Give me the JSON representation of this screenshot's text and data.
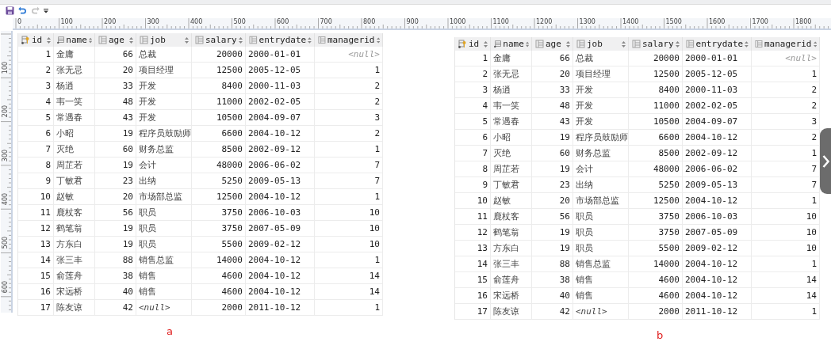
{
  "toolbar": {
    "buttons": [
      {
        "kind": "save",
        "disabled": false
      },
      {
        "kind": "undo",
        "disabled": false
      },
      {
        "kind": "redo",
        "disabled": true
      },
      {
        "kind": "menu",
        "disabled": false
      }
    ]
  },
  "ruler": {
    "horizontal_labels": [
      "0",
      "100",
      "200",
      "300",
      "400",
      "500",
      "600",
      "700",
      "800",
      "900",
      "1000",
      "1100",
      "1200",
      "1300",
      "1400",
      "1500",
      "1600",
      "1700",
      "1800"
    ],
    "vertical_labels": [
      "100",
      "200",
      "300",
      "400",
      "500",
      "600"
    ]
  },
  "tables": [
    {
      "caption": "a",
      "columns": [
        {
          "name": "id",
          "kind": "number"
        },
        {
          "name": "name",
          "kind": "text"
        },
        {
          "name": "age",
          "kind": "number"
        },
        {
          "name": "job",
          "kind": "text"
        },
        {
          "name": "salary",
          "kind": "number"
        },
        {
          "name": "entrydate",
          "kind": "text"
        },
        {
          "name": "managerid",
          "kind": "number"
        }
      ],
      "rows": [
        [
          "1",
          "金庸",
          "66",
          "总裁",
          "20000",
          "2000-01-01",
          {
            "text": "<null>",
            "kind": "null"
          }
        ],
        [
          "2",
          "张无忌",
          "20",
          "项目经理",
          "12500",
          "2005-12-05",
          "1"
        ],
        [
          "3",
          "杨逍",
          "33",
          "开发",
          "8400",
          "2000-11-03",
          "2"
        ],
        [
          "4",
          "韦一笑",
          "48",
          "开发",
          "11000",
          "2002-02-05",
          "2"
        ],
        [
          "5",
          "常遇春",
          "43",
          "开发",
          "10500",
          "2004-09-07",
          "3"
        ],
        [
          "6",
          "小昭",
          "19",
          "程序员鼓励师",
          "6600",
          "2004-10-12",
          "2"
        ],
        [
          "7",
          "灭绝",
          "60",
          "财务总监",
          "8500",
          "2002-09-12",
          "1"
        ],
        [
          "8",
          "周芷若",
          "19",
          "会计",
          "48000",
          "2006-06-02",
          "7"
        ],
        [
          "9",
          "丁敏君",
          "23",
          "出纳",
          "5250",
          "2009-05-13",
          "7"
        ],
        [
          "10",
          "赵敏",
          "20",
          "市场部总监",
          "12500",
          "2004-10-12",
          "1"
        ],
        [
          "11",
          "鹿杖客",
          "56",
          "职员",
          "3750",
          "2006-10-03",
          "10"
        ],
        [
          "12",
          "鹤笔翁",
          "19",
          "职员",
          "3750",
          "2007-05-09",
          "10"
        ],
        [
          "13",
          "方东白",
          "19",
          "职员",
          "5500",
          "2009-02-12",
          "10"
        ],
        [
          "14",
          "张三丰",
          "88",
          "销售总监",
          "14000",
          "2004-10-12",
          "1"
        ],
        [
          "15",
          "俞莲舟",
          "38",
          "销售",
          "4600",
          "2004-10-12",
          "14"
        ],
        [
          "16",
          "宋远桥",
          "40",
          "销售",
          "4600",
          "2004-10-12",
          "14"
        ],
        [
          "17",
          "陈友谅",
          "42",
          {
            "text": "<null>",
            "kind": "null"
          },
          "2000",
          "2011-10-12",
          "1"
        ]
      ]
    },
    {
      "caption": "b",
      "columns": [
        {
          "name": "id",
          "kind": "number"
        },
        {
          "name": "name",
          "kind": "text"
        },
        {
          "name": "age",
          "kind": "number"
        },
        {
          "name": "job",
          "kind": "text"
        },
        {
          "name": "salary",
          "kind": "number"
        },
        {
          "name": "entrydate",
          "kind": "text"
        },
        {
          "name": "managerid",
          "kind": "number"
        }
      ],
      "rows": [
        [
          "1",
          "金庸",
          "66",
          "总裁",
          "20000",
          "2000-01-01",
          {
            "text": "<null>",
            "kind": "null"
          }
        ],
        [
          "2",
          "张无忌",
          "20",
          "项目经理",
          "12500",
          "2005-12-05",
          "1"
        ],
        [
          "3",
          "杨逍",
          "33",
          "开发",
          "8400",
          "2000-11-03",
          "2"
        ],
        [
          "4",
          "韦一笑",
          "48",
          "开发",
          "11000",
          "2002-02-05",
          "2"
        ],
        [
          "5",
          "常遇春",
          "43",
          "开发",
          "10500",
          "2004-09-07",
          "3"
        ],
        [
          "6",
          "小昭",
          "19",
          "程序员鼓励师",
          "6600",
          "2004-10-12",
          "2"
        ],
        [
          "7",
          "灭绝",
          "60",
          "财务总监",
          "8500",
          "2002-09-12",
          "1"
        ],
        [
          "8",
          "周芷若",
          "19",
          "会计",
          "48000",
          "2006-06-02",
          "7"
        ],
        [
          "9",
          "丁敏君",
          "23",
          "出纳",
          "5250",
          "2009-05-13",
          "7"
        ],
        [
          "10",
          "赵敏",
          "20",
          "市场部总监",
          "12500",
          "2004-10-12",
          "1"
        ],
        [
          "11",
          "鹿杖客",
          "56",
          "职员",
          "3750",
          "2006-10-03",
          "10"
        ],
        [
          "12",
          "鹤笔翁",
          "19",
          "职员",
          "3750",
          "2007-05-09",
          "10"
        ],
        [
          "13",
          "方东白",
          "19",
          "职员",
          "5500",
          "2009-02-12",
          "10"
        ],
        [
          "14",
          "张三丰",
          "88",
          "销售总监",
          "14000",
          "2004-10-12",
          "1"
        ],
        [
          "15",
          "俞莲舟",
          "38",
          "销售",
          "4600",
          "2004-10-12",
          "14"
        ],
        [
          "16",
          "宋远桥",
          "40",
          "销售",
          "4600",
          "2004-10-12",
          "14"
        ],
        [
          "17",
          "陈友谅",
          "42",
          {
            "text": "<null>",
            "kind": "null"
          },
          "2000",
          "2011-10-12",
          "1"
        ]
      ]
    }
  ]
}
